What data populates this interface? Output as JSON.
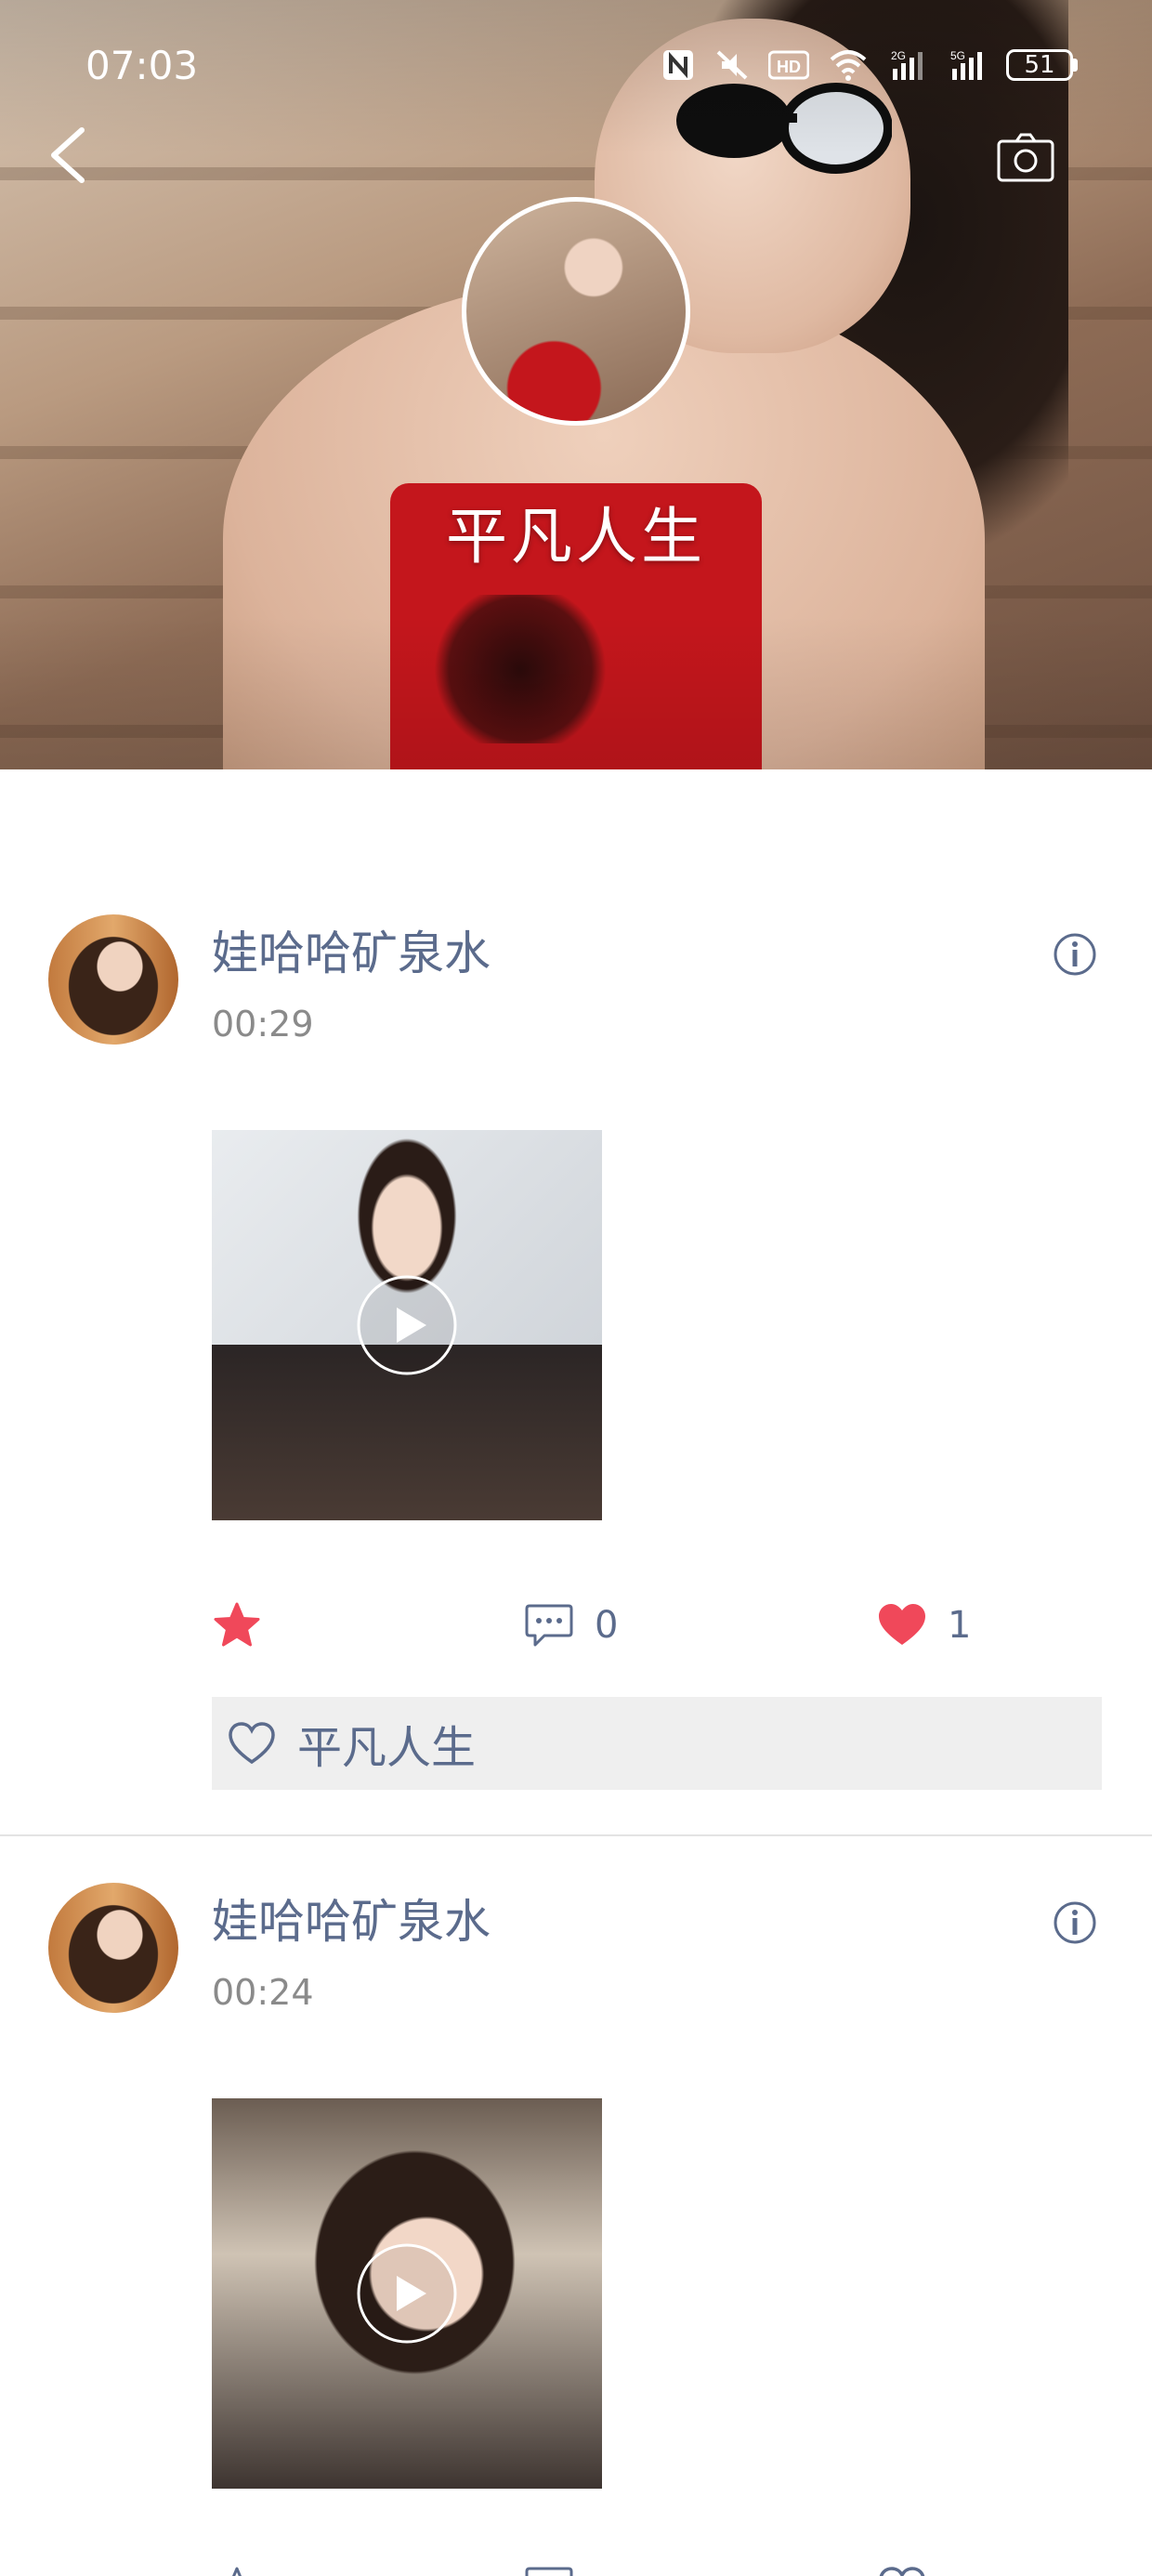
{
  "status_bar": {
    "time": "07:03",
    "battery": "51",
    "icons": [
      "nfc-icon",
      "mute-icon",
      "hd-icon",
      "wifi-icon",
      "signal-2g-icon",
      "signal-5g-icon",
      "battery-icon"
    ]
  },
  "header": {
    "profile_name": "平凡人生",
    "back_icon": "chevron-left-icon",
    "camera_icon": "camera-icon"
  },
  "colors": {
    "link_text": "#5b6b8c",
    "time_text": "#8a8a8a",
    "accent_red": "#f0485a",
    "likes_bg": "#efefef"
  },
  "posts": [
    {
      "user": "娃哈哈矿泉水",
      "time": "00:29",
      "comment_count": "0",
      "like_count": "1",
      "liked_by": "平凡人生",
      "starred": true
    },
    {
      "user": "娃哈哈矿泉水",
      "time": "00:24"
    }
  ]
}
